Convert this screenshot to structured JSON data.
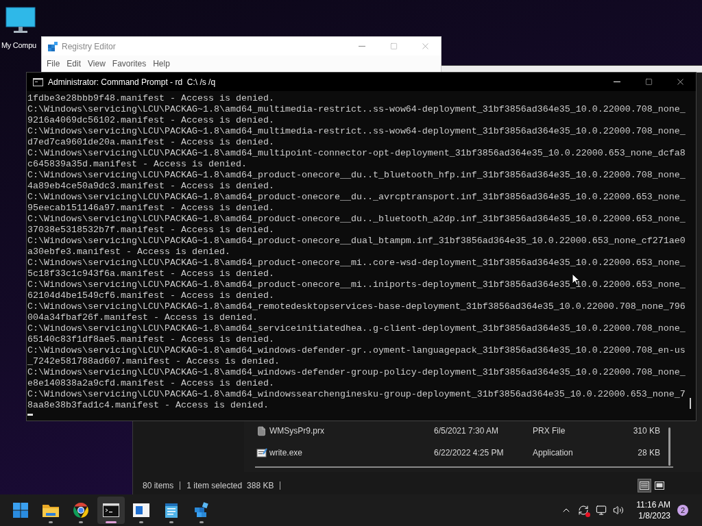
{
  "desktop_icons": [
    {
      "label": "My Compu"
    }
  ],
  "registry_editor": {
    "title": "Registry Editor",
    "menu": [
      "File",
      "Edit",
      "View",
      "Favorites",
      "Help"
    ]
  },
  "file_explorer": {
    "files": [
      {
        "name": "WMSysPr9.prx",
        "date_modified": "6/5/2021 7:30 AM",
        "type": "PRX File",
        "size": "310 KB",
        "kind": "file"
      },
      {
        "name": "write.exe",
        "date_modified": "6/22/2022 4:25 PM",
        "type": "Application",
        "size": "28 KB",
        "kind": "app"
      }
    ],
    "status_bar": {
      "item_count": "80 items",
      "selection": "1 item selected",
      "selection_size": "388 KB"
    },
    "view_buttons": [
      {
        "kind": "details",
        "selected": true
      },
      {
        "kind": "tiles",
        "selected": false
      }
    ]
  },
  "command_prompt": {
    "title": "Administrator: Command Prompt - rd  C:\\ /s /q",
    "lines": [
      "1fdbe3e28bbb9f48.manifest - Access is denied.",
      "C:\\Windows\\servicing\\LCU\\PACKAG~1.8\\amd64_multimedia-restrict..ss-wow64-deployment_31bf3856ad364e35_10.0.22000.708_none_",
      "9216a4069dc56102.manifest - Access is denied.",
      "C:\\Windows\\servicing\\LCU\\PACKAG~1.8\\amd64_multimedia-restrict..ss-wow64-deployment_31bf3856ad364e35_10.0.22000.708_none_",
      "d7ed7ca9601de20a.manifest - Access is denied.",
      "C:\\Windows\\servicing\\LCU\\PACKAG~1.8\\amd64_multipoint-connector-opt-deployment_31bf3856ad364e35_10.0.22000.653_none_dcfa8",
      "c645839a35d.manifest - Access is denied.",
      "C:\\Windows\\servicing\\LCU\\PACKAG~1.8\\amd64_product-onecore__du..t_bluetooth_hfp.inf_31bf3856ad364e35_10.0.22000.708_none_",
      "4a89eb4ce50a9dc3.manifest - Access is denied.",
      "C:\\Windows\\servicing\\LCU\\PACKAG~1.8\\amd64_product-onecore__du.._avrcptransport.inf_31bf3856ad364e35_10.0.22000.653_none_",
      "95eecab151146a97.manifest - Access is denied.",
      "C:\\Windows\\servicing\\LCU\\PACKAG~1.8\\amd64_product-onecore__du.._bluetooth_a2dp.inf_31bf3856ad364e35_10.0.22000.653_none_",
      "37038e5318532b7f.manifest - Access is denied.",
      "C:\\Windows\\servicing\\LCU\\PACKAG~1.8\\amd64_product-onecore__dual_btampm.inf_31bf3856ad364e35_10.0.22000.653_none_cf271ae0",
      "a30ebfe3.manifest - Access is denied.",
      "C:\\Windows\\servicing\\LCU\\PACKAG~1.8\\amd64_product-onecore__mi..core-wsd-deployment_31bf3856ad364e35_10.0.22000.653_none_",
      "5c18f33c1c943f6a.manifest - Access is denied.",
      "C:\\Windows\\servicing\\LCU\\PACKAG~1.8\\amd64_product-onecore__mi..iniports-deployment_31bf3856ad364e35_10.0.22000.653_none_",
      "62104d4be1549cf6.manifest - Access is denied.",
      "C:\\Windows\\servicing\\LCU\\PACKAG~1.8\\amd64_remotedesktopservices-base-deployment_31bf3856ad364e35_10.0.22000.708_none_796",
      "004a34fbaf26f.manifest - Access is denied.",
      "C:\\Windows\\servicing\\LCU\\PACKAG~1.8\\amd64_serviceinitiatedhea..g-client-deployment_31bf3856ad364e35_10.0.22000.708_none_",
      "65140c83f1df8ae5.manifest - Access is denied.",
      "C:\\Windows\\servicing\\LCU\\PACKAG~1.8\\amd64_windows-defender-gr..oyment-languagepack_31bf3856ad364e35_10.0.22000.708_en-us",
      "_7242e581788ad607.manifest - Access is denied.",
      "C:\\Windows\\servicing\\LCU\\PACKAG~1.8\\amd64_windows-defender-group-policy-deployment_31bf3856ad364e35_10.0.22000.708_none_",
      "e8e140838a2a9cfd.manifest - Access is denied.",
      "C:\\Windows\\servicing\\LCU\\PACKAG~1.8\\amd64_windowssearchenginesku-group-deployment_31bf3856ad364e35_10.0.22000.653_none_7",
      "8aa8e38b3fad1c4.manifest - Access is denied."
    ]
  },
  "taskbar": {
    "apps": [
      {
        "kind": "start",
        "selected": false
      },
      {
        "kind": "folder",
        "selected": false
      },
      {
        "kind": "browser",
        "selected": false
      },
      {
        "kind": "terminal",
        "selected": true
      },
      {
        "kind": "window",
        "selected": false
      },
      {
        "kind": "notepad",
        "selected": false
      },
      {
        "kind": "registry",
        "selected": false
      }
    ],
    "clock": {
      "time": "11:16 AM",
      "date": "1/8/2023"
    },
    "notification_badge": "2"
  }
}
